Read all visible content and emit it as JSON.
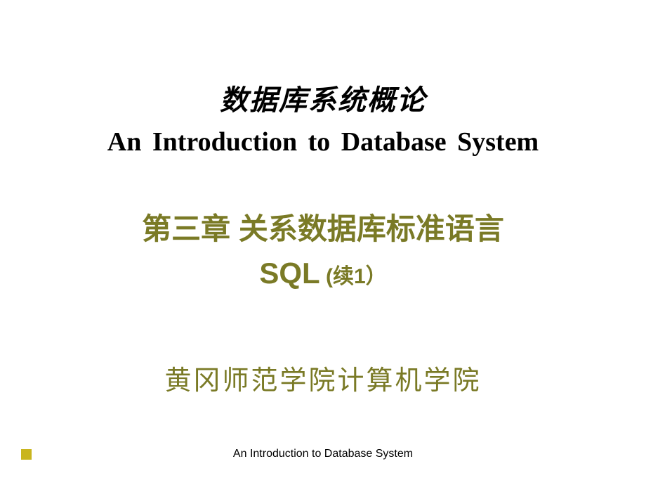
{
  "title": {
    "chinese": "数据库系统概论",
    "english": "An Introduction to Database System"
  },
  "chapter": {
    "line1": "第三章 关系数据库标准语言",
    "line2_main": "SQL",
    "line2_sub": " (续1）"
  },
  "institution": "黄冈师范学院计算机学院",
  "footer": "An Introduction to Database System",
  "colors": {
    "olive": "#7a7a26",
    "accent": "#c9b51e"
  }
}
